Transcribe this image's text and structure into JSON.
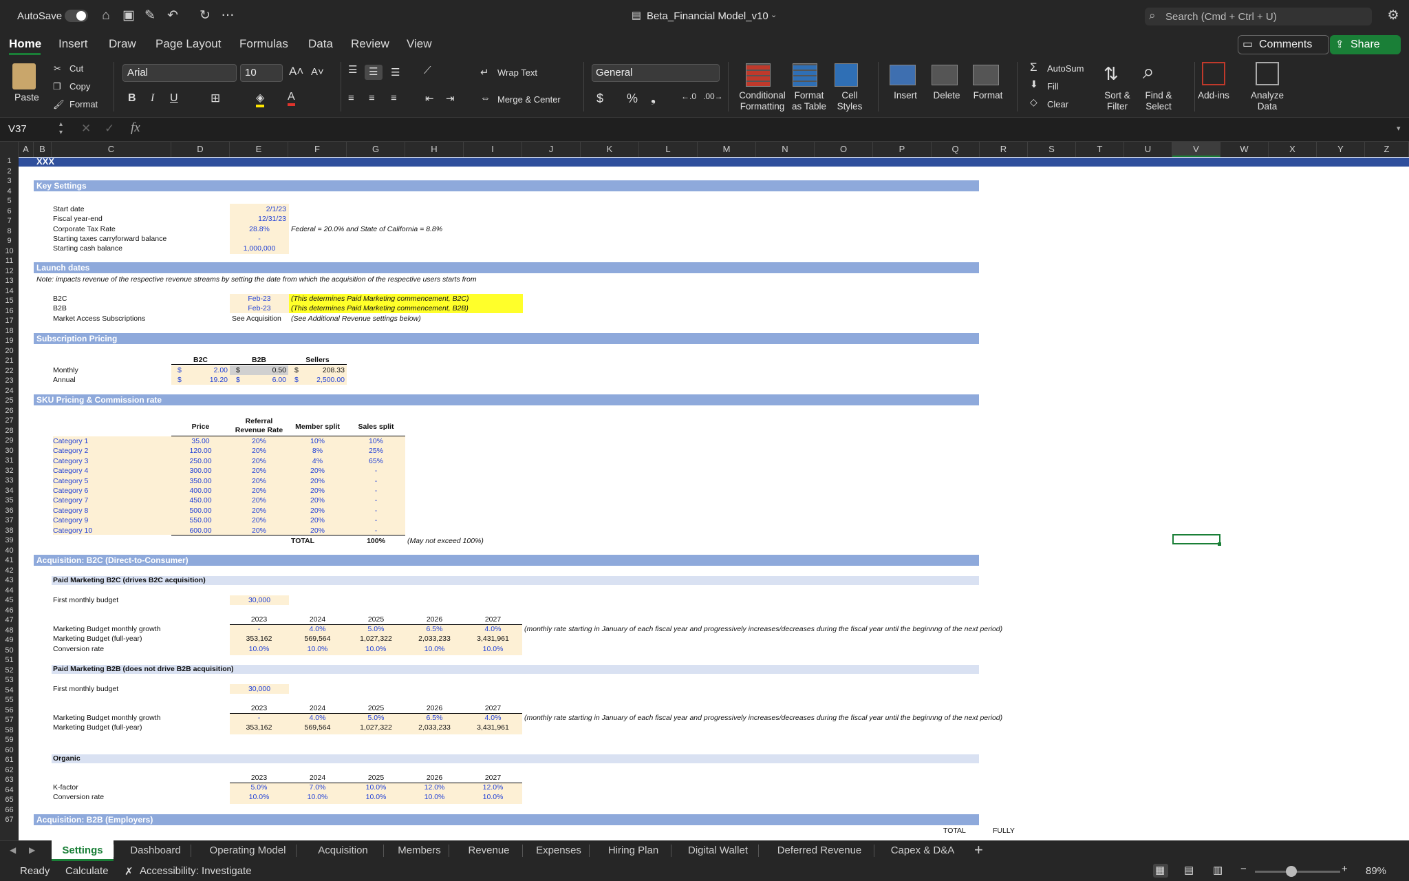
{
  "titlebar": {
    "autosave_label": "AutoSave",
    "doc_title": "Beta_Financial Model_v10",
    "search_placeholder": "Search (Cmd + Ctrl + U)"
  },
  "ribbon_tabs": [
    "Home",
    "Insert",
    "Draw",
    "Page Layout",
    "Formulas",
    "Data",
    "Review",
    "View"
  ],
  "ribbon_buttons": {
    "comments": "Comments",
    "share": "Share",
    "paste": "Paste",
    "cut": "Cut",
    "copy": "Copy",
    "format_painter": "Format",
    "font_name": "Arial",
    "font_size": "10",
    "wrap_text": "Wrap Text",
    "merge_center": "Merge & Center",
    "number_format": "General",
    "conditional_formatting": "Conditional\nFormatting",
    "format_as_table": "Format\nas Table",
    "cell_styles": "Cell\nStyles",
    "insert": "Insert",
    "delete": "Delete",
    "format": "Format",
    "autosum": "AutoSum",
    "fill": "Fill",
    "clear": "Clear",
    "sort_filter": "Sort &\nFilter",
    "find_select": "Find &\nSelect",
    "add_ins": "Add-ins",
    "analyze_data": "Analyze\nData"
  },
  "formula_bar": {
    "name_box": "V37",
    "formula": ""
  },
  "columns": [
    "A",
    "B",
    "C",
    "D",
    "E",
    "F",
    "G",
    "H",
    "I",
    "J",
    "K",
    "L",
    "M",
    "N",
    "O",
    "P",
    "Q",
    "R",
    "S",
    "T",
    "U",
    "V",
    "W",
    "X",
    "Y",
    "Z"
  ],
  "selected_cell": "V37",
  "sheet": {
    "title": "XXX",
    "key_settings": {
      "header": "Key Settings",
      "rows": [
        {
          "label": "Start date",
          "value": "2/1/23"
        },
        {
          "label": "Fiscal year-end",
          "value": "12/31/23"
        },
        {
          "label": "Corporate Tax Rate",
          "value": "28.8%",
          "note": "Federal = 20.0% and State of California = 8.8%"
        },
        {
          "label": "Starting taxes carryforward balance",
          "value": "-"
        },
        {
          "label": "Starting cash balance",
          "value": "1,000,000"
        }
      ]
    },
    "launch": {
      "header": "Launch dates",
      "note": "Note: impacts revenue of the respective revenue streams by setting the date from which the acquisition of the respective users starts from",
      "rows": [
        {
          "label": "B2C",
          "value": "Feb-23",
          "note": "(This determines Paid Marketing commencement, B2C)"
        },
        {
          "label": "B2B",
          "value": "Feb-23",
          "note": "(This determines Paid Marketing commencement, B2B)"
        },
        {
          "label": "Market Access Subscriptions",
          "value": "See Acquisition",
          "note": "(See Additional Revenue settings below)"
        }
      ]
    },
    "subscription": {
      "header": "Subscription Pricing",
      "cols": [
        "B2C",
        "B2B",
        "Sellers"
      ],
      "rows": [
        {
          "label": "Monthly",
          "values": [
            "2.00",
            "0.50",
            "208.33"
          ]
        },
        {
          "label": "Annual",
          "values": [
            "19.20",
            "6.00",
            "2,500.00"
          ]
        }
      ],
      "currency": "$"
    },
    "sku": {
      "header": "SKU Pricing & Commission rate",
      "cols": [
        "Price",
        "Referral\nRevenue Rate",
        "Member split",
        "Sales split"
      ],
      "rows": [
        [
          "Category 1",
          "35.00",
          "20%",
          "10%",
          "10%"
        ],
        [
          "Category 2",
          "120.00",
          "20%",
          "8%",
          "25%"
        ],
        [
          "Category 3",
          "250.00",
          "20%",
          "4%",
          "65%"
        ],
        [
          "Category 4",
          "300.00",
          "20%",
          "20%",
          "-"
        ],
        [
          "Category 5",
          "350.00",
          "20%",
          "20%",
          "-"
        ],
        [
          "Category 6",
          "400.00",
          "20%",
          "20%",
          "-"
        ],
        [
          "Category 7",
          "450.00",
          "20%",
          "20%",
          "-"
        ],
        [
          "Category 8",
          "500.00",
          "20%",
          "20%",
          "-"
        ],
        [
          "Category 9",
          "550.00",
          "20%",
          "20%",
          "-"
        ],
        [
          "Category 10",
          "600.00",
          "20%",
          "20%",
          "-"
        ]
      ],
      "total_label": "TOTAL",
      "total_value": "100%",
      "total_note": "(May not exceed 100%)"
    },
    "acq_b2c": {
      "header": "Acquisition: B2C (Direct-to-Consumer)",
      "paid_b2c_header": "Paid Marketing B2C (drives B2C acquisition)",
      "first_budget_label": "First monthly budget",
      "first_budget_value": "30,000",
      "years": [
        "2023",
        "2024",
        "2025",
        "2026",
        "2027"
      ],
      "growth_label": "Marketing Budget monthly growth",
      "growth": [
        "-",
        "4.0%",
        "5.0%",
        "6.5%",
        "4.0%"
      ],
      "growth_note": "(monthly rate starting in January of each fiscal year and progressively increases/decreases during the fiscal year until the beginnng of the next period)",
      "budget_label": "Marketing Budget (full-year)",
      "budget": [
        "353,162",
        "569,564",
        "1,027,322",
        "2,033,233",
        "3,431,961"
      ],
      "conv_label": "Conversion rate",
      "conv": [
        "10.0%",
        "10.0%",
        "10.0%",
        "10.0%",
        "10.0%"
      ],
      "paid_b2b_header": "Paid Marketing B2B (does not drive B2B acquisition)",
      "b2b_first_budget_value": "30,000",
      "b2b_growth": [
        "-",
        "4.0%",
        "5.0%",
        "6.5%",
        "4.0%"
      ],
      "b2b_budget": [
        "353,162",
        "569,564",
        "1,027,322",
        "2,033,233",
        "3,431,961"
      ],
      "organic_header": "Organic",
      "kfactor_label": "K-factor",
      "kfactor": [
        "5.0%",
        "7.0%",
        "10.0%",
        "12.0%",
        "12.0%"
      ],
      "org_conv": [
        "10.0%",
        "10.0%",
        "10.0%",
        "10.0%",
        "10.0%"
      ]
    },
    "acq_b2b": {
      "header": "Acquisition: B2B (Employers)",
      "total_label": "TOTAL",
      "fully_label": "FULLY"
    }
  },
  "sheet_tabs": [
    "Settings",
    "Dashboard",
    "Operating Model",
    "Acquisition",
    "Members",
    "Revenue",
    "Expenses",
    "Hiring Plan",
    "Digital Wallet",
    "Deferred Revenue",
    "Capex & D&A"
  ],
  "active_sheet": "Settings",
  "status": {
    "ready": "Ready",
    "calculate": "Calculate",
    "accessibility": "Accessibility: Investigate",
    "zoom": "89%"
  },
  "colors": {
    "band": "#8ea9db",
    "subband": "#d9e1f2",
    "title_band": "#2f4f9c",
    "input_fill": "#fdf0d5",
    "highlight": "#ffff2a",
    "accent": "#1a7f37"
  }
}
